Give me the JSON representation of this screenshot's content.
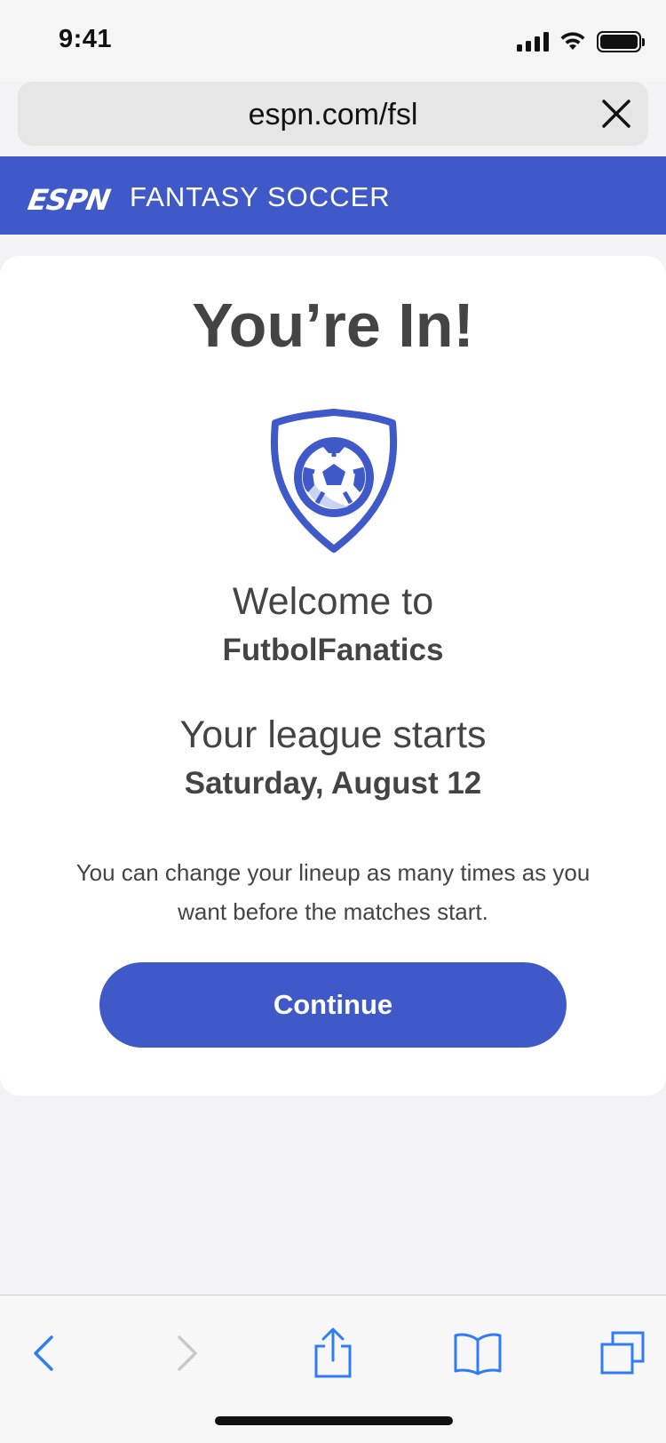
{
  "status_bar": {
    "time": "9:41"
  },
  "browser": {
    "url": "espn.com/fsl"
  },
  "header": {
    "logo": "ESPN",
    "title": "FANTASY SOCCER"
  },
  "card": {
    "headline": "You’re In!",
    "welcome": "Welcome to",
    "league_name": "FutbolFanatics",
    "starts_label": "Your league starts",
    "start_date": "Saturday, August 12",
    "description": "You can change your lineup as many times as you want before the matches start.",
    "continue_label": "Continue",
    "badge_icon": "soccer-shield-icon"
  },
  "toolbar": {
    "icons": [
      "back-icon",
      "forward-icon",
      "share-icon",
      "bookmarks-icon",
      "tabs-icon"
    ]
  },
  "colors": {
    "accent": "#3f5ac8",
    "text": "#444444",
    "ios_blue": "#2f7cf6"
  }
}
